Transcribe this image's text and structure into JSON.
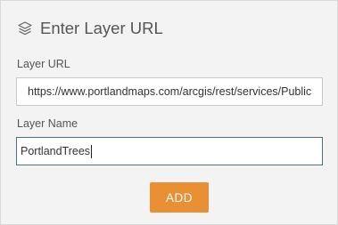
{
  "dialog": {
    "title": "Enter Layer URL",
    "icon": "layers-icon"
  },
  "form": {
    "url_label": "Layer URL",
    "url_value": "https://www.portlandmaps.com/arcgis/rest/services/Public",
    "name_label": "Layer Name",
    "name_value": "PortlandTrees"
  },
  "actions": {
    "add_label": "ADD",
    "add_color": "#e98f34"
  }
}
